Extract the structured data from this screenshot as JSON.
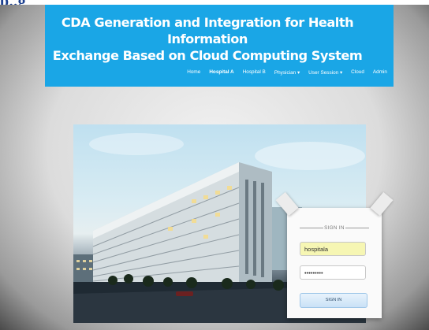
{
  "page_fragment": "p..g",
  "header": {
    "title_line1": "CDA Generation and Integration for Health Information",
    "title_line2": "Exchange Based on Cloud Computing System",
    "bg_color": "#1aa6e6",
    "nav": [
      {
        "label": "Home",
        "active": false
      },
      {
        "label": "Hospital A",
        "active": true
      },
      {
        "label": "Hospital B",
        "active": false
      },
      {
        "label": "Physician ▾",
        "active": false
      },
      {
        "label": "User Session ▾",
        "active": false
      },
      {
        "label": "Cloud",
        "active": false
      },
      {
        "label": "Admin",
        "active": false
      }
    ]
  },
  "signin": {
    "title": "SIGN IN",
    "username_value": "hospitala",
    "password_value": "•••••••••",
    "button_label": "SIGN IN"
  }
}
